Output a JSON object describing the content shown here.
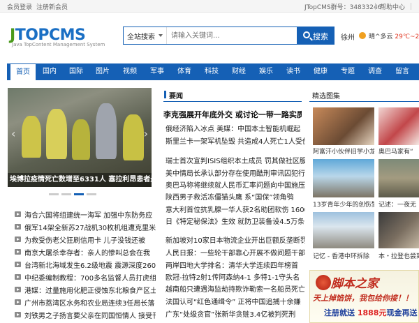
{
  "topbar": {
    "login": "会员登录",
    "register": "注册新会员",
    "qq": "JTopCMS群号：34833246",
    "help": "帮助中心",
    "more": "|"
  },
  "header": {
    "logo_j": "J",
    "logo_rest": "TOPCMS",
    "logo_sub": "Java TopContent Management System",
    "search_select": "全站搜索",
    "search_placeholder": "请输入关键词...",
    "search_button": "搜索",
    "city": "徐州",
    "weather_text": "晴^多云",
    "weather_temp": "29℃~21℃",
    "colors": {
      "brand_blue": "#1560b5",
      "logo_green": "#4a9a1c"
    }
  },
  "nav": {
    "items": [
      "首页",
      "国内",
      "国际",
      "图片",
      "视频",
      "军事",
      "体育",
      "科技",
      "财经",
      "娱乐",
      "读书",
      "健康",
      "专题",
      "调查",
      "留言"
    ],
    "active_index": 0
  },
  "slider": {
    "caption": "埃博拉疫情死亡数增至6331人 塞拉利昂患者最",
    "prev_icon": "chevron-left-icon",
    "next_icon": "chevron-right-icon",
    "active_dot": 2
  },
  "left_news": [
    "海合六国将组建统一海军 加强中东防务应",
    "俄军14架全新苏27战机30枚机组遭克里米",
    "为救受伤老父狂刷信用卡 儿子没钱还被",
    "南京大屠杀幸存者：亲人的惨叫总会在我",
    "台湾新北海域发生6.2级地震 震源深度260",
    "中纪委编制教程：700多名监督人员打虎组",
    "港媒：过量施用化肥正侵蚀东北粮食产区土",
    "广州市荔湾区水务和农业局连续3任局长落",
    "刘铁男之子扬言要父亲在同国恒情人 接受刊"
  ],
  "middle": {
    "section_title": "要闻",
    "headline": "李克强展开年底外交 或讨论一带一路实质",
    "items": [
      "俄经济陷入冰点 美媒：中国本土智能机崛起",
      "斯里兰卡一架军机坠毁 共造成4人死亡1人受伤",
      "瑞士首次宣判ISIS组织本土成员 罚其做社区服务",
      "美中情局长承认部分存在使用酷刑审讯囚犯行",
      "奥巴马称将继续就人民币汇率问题向中国施压",
      "陕西男子救活冻僵猫头鹰 系“国保”领角鸮",
      "意大利首位抗乳腺一华人获2名助团软伤 1600欧元",
      "日《特定秘保法》生效 就防卫装备设4.5万条",
      "新加坡对10家日本物流企业开出巨额反垄断罚",
      "人民日报：一些轮干部靠心开展不做间题干部",
      "两岸四地大学排名：清华大学连续四年榜首",
      "欧冠-拉特2射1传阿森纳4-1 多特1-1守头名",
      "越南船只遭遇海监劫持欺诈勒索一名船员死亡",
      "法国认可“红色通缉令” 正将中国追捕十余嫌",
      "广东“处级贪官”张新华贪赃3.4亿被判死刑"
    ]
  },
  "gallery": {
    "section_title": "精选图集",
    "items": [
      "阿富汗小伙伴旧学小龙走红",
      "奥巴马家有“",
      "13岁青年少年的创伤梦",
      "记述：一夜无",
      "记忆 - 香港中环拆除",
      "本・拉登也尝到"
    ]
  },
  "ad": {
    "line1": "脚本之家",
    "line2": "天上掉馅饼，我包给你接！！",
    "line3_a": "注册就送",
    "line3_b": "1888元",
    "line3_c": "现金再送"
  }
}
